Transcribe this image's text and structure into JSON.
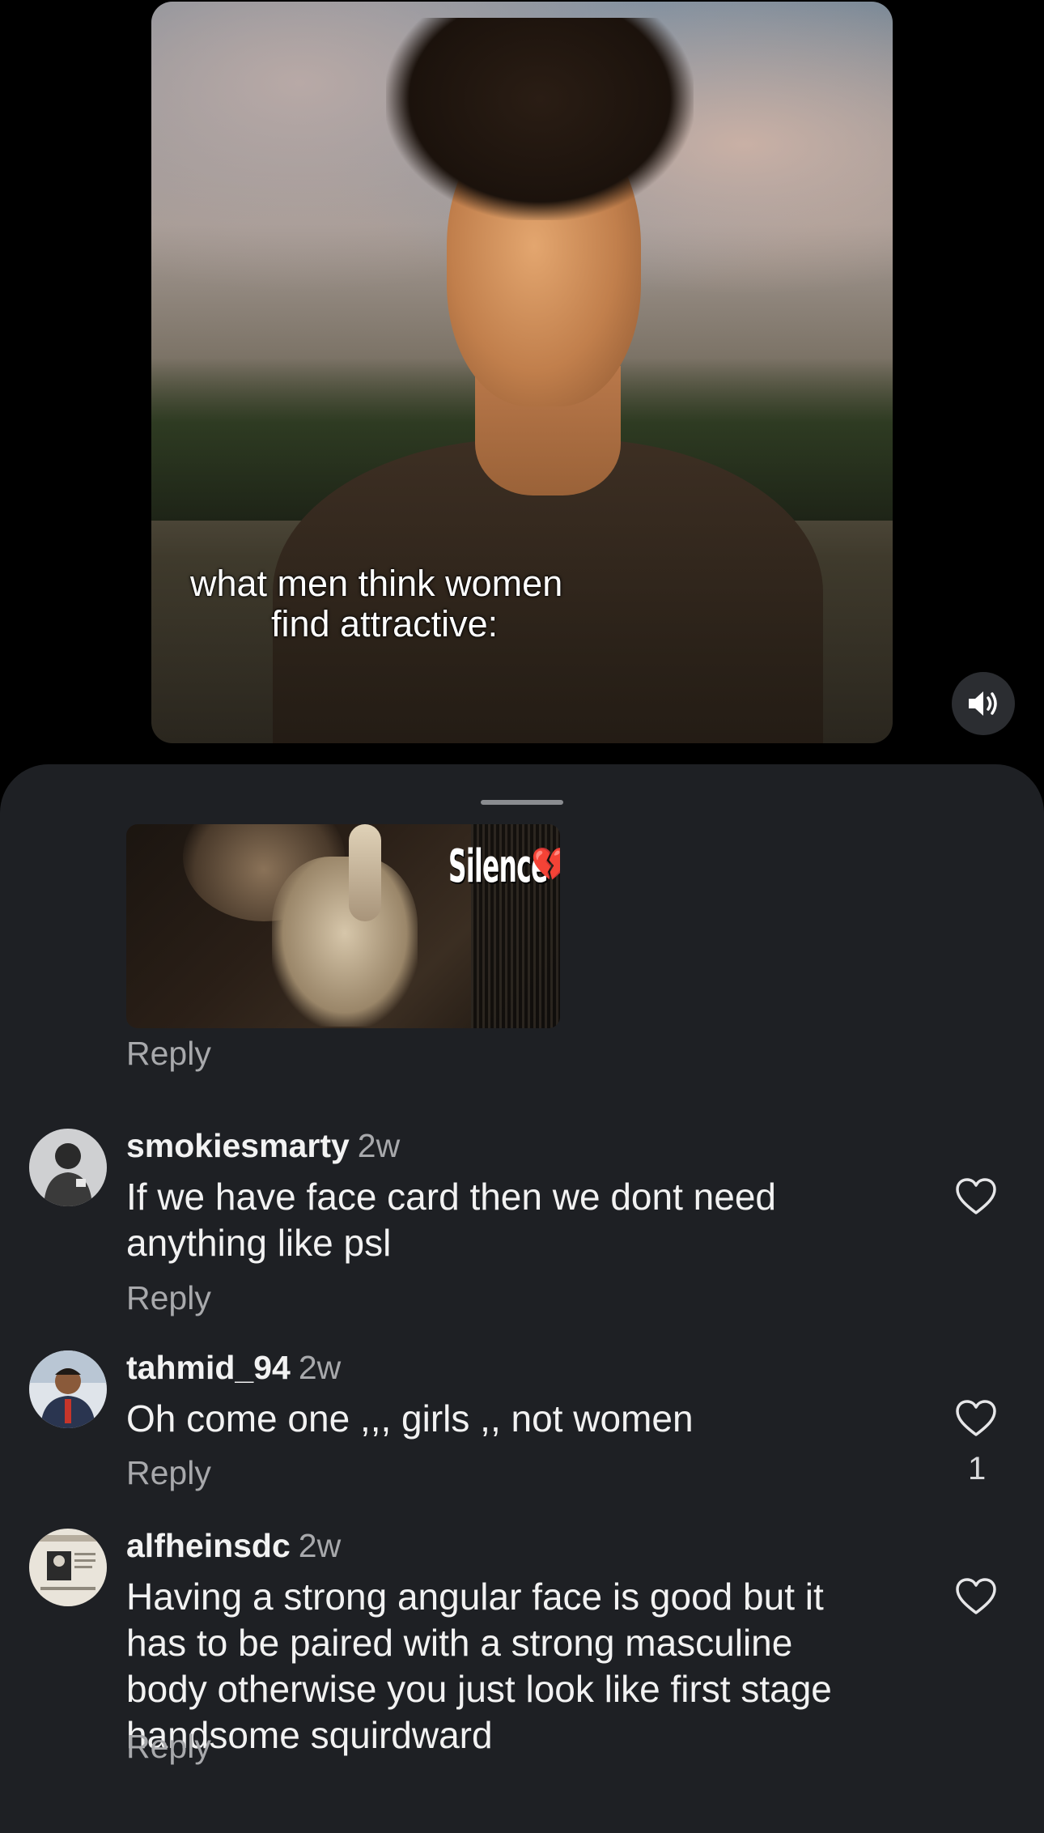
{
  "video": {
    "caption_line1": "what men think women",
    "caption_line2": "find attractive:",
    "mute_icon": "speaker-icon"
  },
  "gif_comment": {
    "gif_text": "Silence",
    "gif_emoji": "💔",
    "reply_label": "Reply"
  },
  "comments": [
    {
      "username": "smokiesmarty",
      "time": "2w",
      "text": "If we have face card then we dont need anything like psl",
      "reply_label": "Reply",
      "likes": ""
    },
    {
      "username": "tahmid_94",
      "time": "2w",
      "text": "Oh come one ,,, girls ,, not women",
      "reply_label": "Reply",
      "likes": "1"
    },
    {
      "username": "alfheinsdc",
      "time": "2w",
      "text": "Having a strong angular face is good but it has to be paired with a strong masculine body otherwise you just look like first stage handsome squirdward",
      "reply_label": "Reply",
      "likes": ""
    }
  ],
  "colors": {
    "sheet_bg": "#1e2024",
    "secondary_text": "#a8a9ac",
    "primary_text": "#f2f2f2"
  }
}
